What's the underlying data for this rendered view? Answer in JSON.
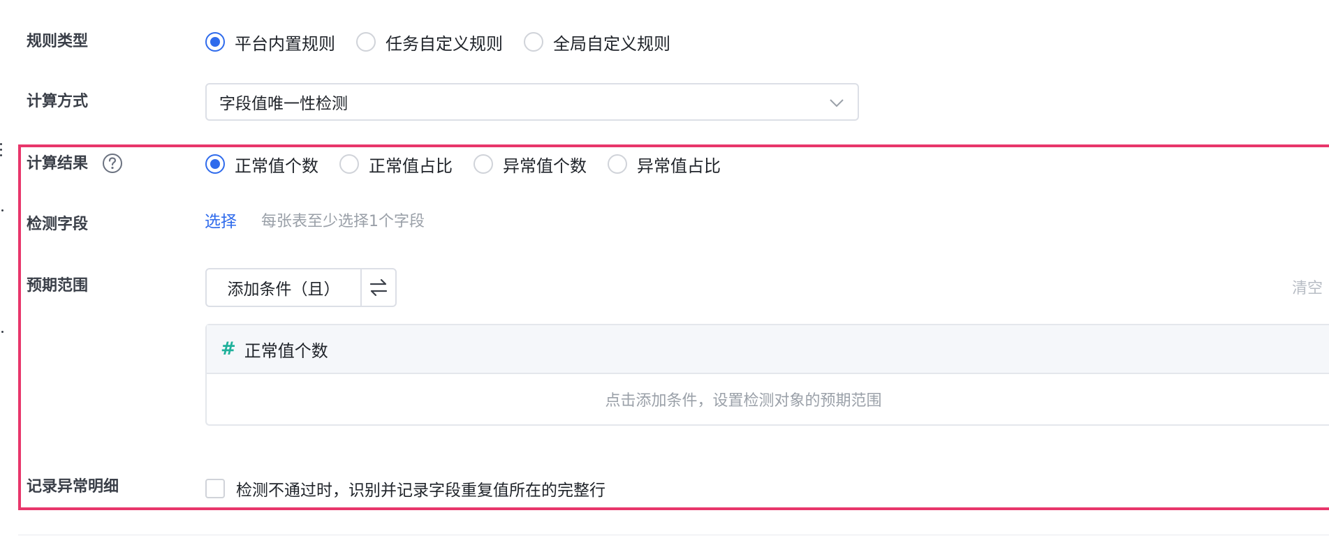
{
  "rule_type": {
    "label": "规则类型",
    "options": [
      "平台内置规则",
      "任务自定义规则",
      "全局自定义规则"
    ],
    "selected": "平台内置规则"
  },
  "calc_method": {
    "label": "计算方式",
    "value": "字段值唯一性检测",
    "chevron_icon": "chevron-down-icon"
  },
  "calc_result": {
    "label": "计算结果",
    "help_icon": "question-circle-icon",
    "options": [
      "正常值个数",
      "正常值占比",
      "异常值个数",
      "异常值占比"
    ],
    "selected": "正常值个数"
  },
  "detect_field": {
    "label": "检测字段",
    "link": "选择",
    "hint": "每张表至少选择1个字段"
  },
  "expected_range": {
    "label": "预期范围",
    "add_condition": "添加条件（且）",
    "swap_icon": "swap-icon",
    "clear": "清空",
    "panel_field_icon": "hash-icon",
    "panel_field": "正常值个数",
    "panel_empty": "点击添加条件，设置检测对象的预期范围"
  },
  "record_detail": {
    "label": "记录异常明细",
    "checkbox_text": "检测不通过时，识别并记录字段重复值所在的完整行",
    "checked": false
  },
  "colors": {
    "accent": "#2f6bec",
    "highlight_frame": "#e8366b",
    "hash": "#1fb19b"
  }
}
